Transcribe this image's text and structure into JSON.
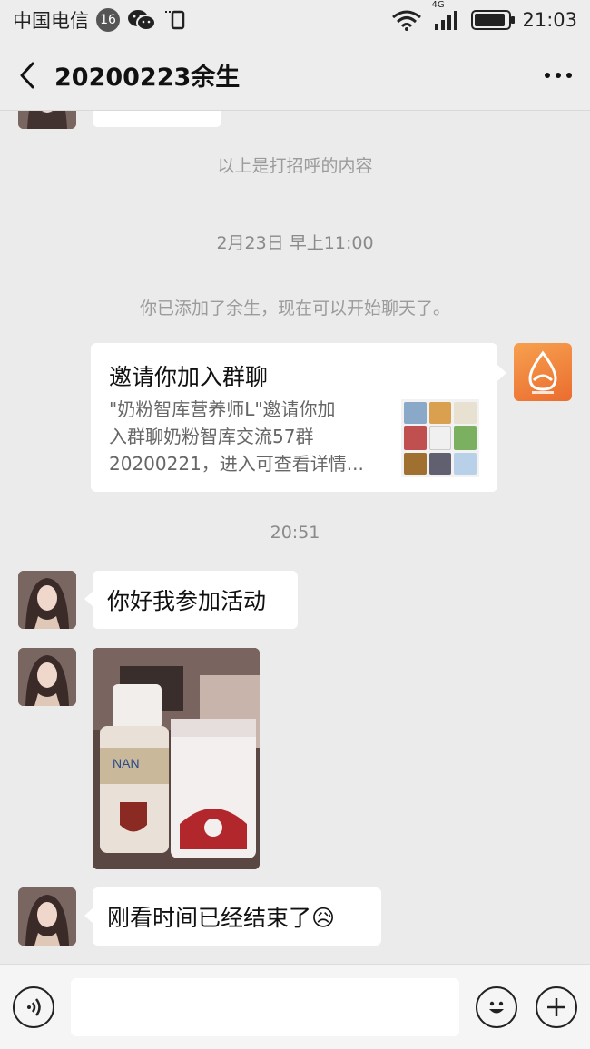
{
  "status_bar": {
    "carrier": "中国电信",
    "notification_count": "16",
    "network": "4G",
    "time": "21:03",
    "battery_level": 0.9
  },
  "header": {
    "title": "20200223余生"
  },
  "messages": {
    "greeting_note": "以上是打招呼的内容",
    "timestamp_1": "2月23日 早上11:00",
    "added_note": "你已添加了余生，现在可以开始聊天了。",
    "invite_card": {
      "title": "邀请你加入群聊",
      "desc_line_1": "\"奶粉智库营养师L\"邀请你加",
      "desc_line_2": "入群聊奶粉智库交流57群",
      "desc_line_3": "20200221，进入可查看详情..."
    },
    "timestamp_2": "20:51",
    "msg_1": "你好我参加活动",
    "msg_3": "刚看时间已经结束了😥"
  },
  "colors": {
    "background": "#ebebeb",
    "bubble": "#ffffff",
    "system_text": "#9b9b9b",
    "brand_orange": "#ee7a36"
  },
  "icons": {
    "back": "chevron-left-icon",
    "more": "more-dots-icon",
    "voice": "voice-icon",
    "emoji": "emoji-icon",
    "plus": "plus-icon"
  }
}
